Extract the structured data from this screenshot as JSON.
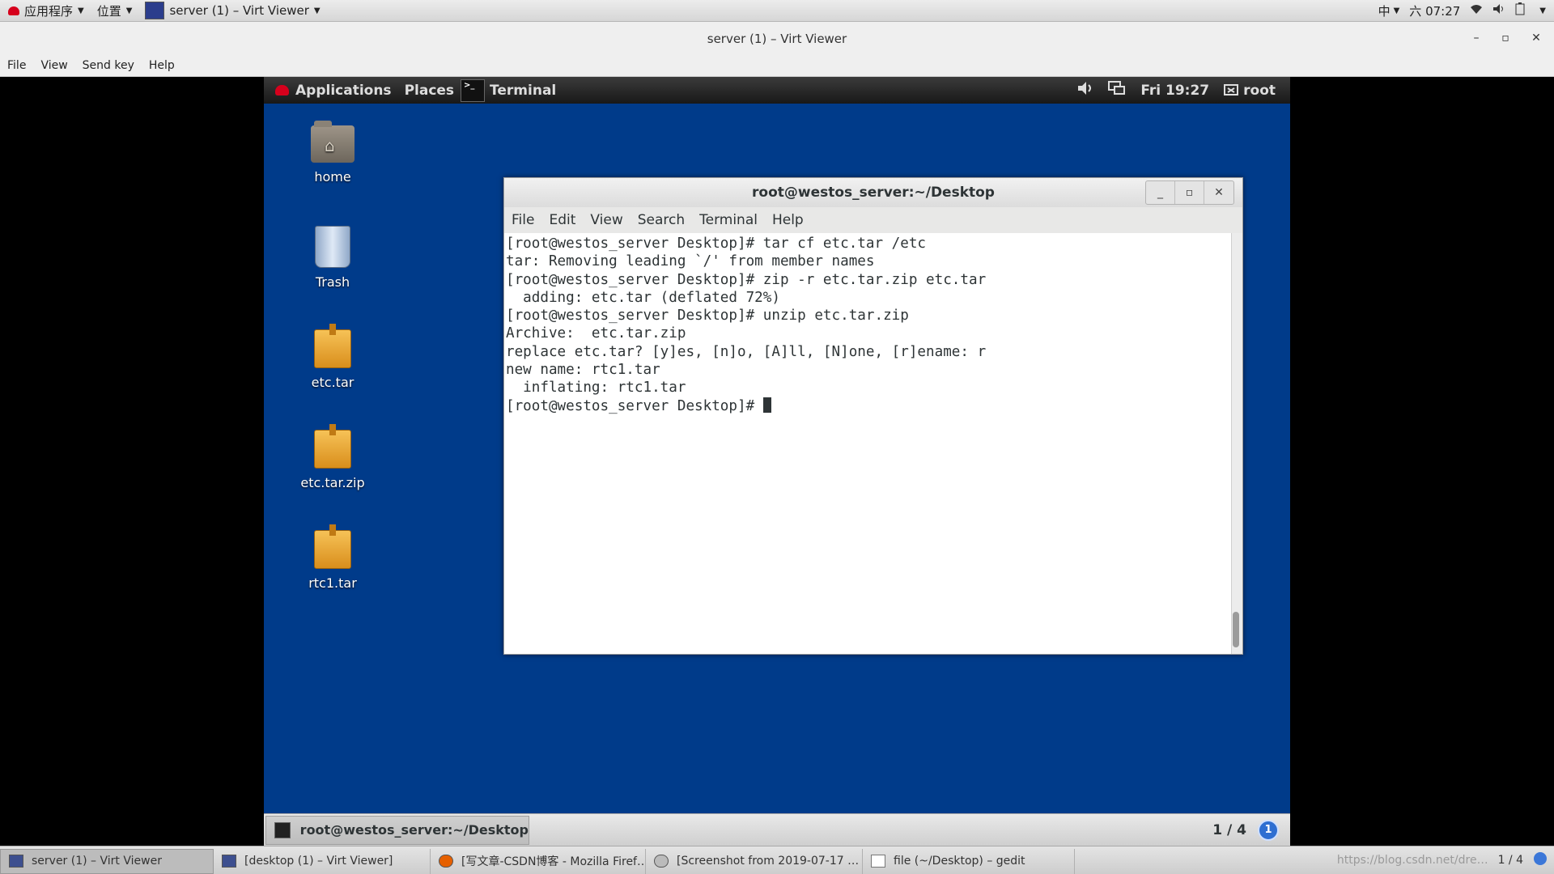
{
  "host_top": {
    "apps_label": "应用程序",
    "places_label": "位置",
    "window_label": "server (1) – Virt Viewer",
    "input_method": "中",
    "clock": "六 07:27"
  },
  "viewer": {
    "title": "server (1) – Virt Viewer",
    "menu": [
      "File",
      "View",
      "Send key",
      "Help"
    ]
  },
  "guest_panel": {
    "applications": "Applications",
    "places": "Places",
    "terminal": "Terminal",
    "clock": "Fri 19:27",
    "user": "root"
  },
  "desktop_icons": [
    {
      "label": "home"
    },
    {
      "label": "Trash"
    },
    {
      "label": "etc.tar"
    },
    {
      "label": "etc.tar.zip"
    },
    {
      "label": "rtc1.tar"
    }
  ],
  "terminal": {
    "title": "root@westos_server:~/Desktop",
    "menu": [
      "File",
      "Edit",
      "View",
      "Search",
      "Terminal",
      "Help"
    ],
    "lines": [
      "[root@westos_server Desktop]# tar cf etc.tar /etc",
      "tar: Removing leading `/' from member names",
      "[root@westos_server Desktop]# zip -r etc.tar.zip etc.tar",
      "  adding: etc.tar (deflated 72%)",
      "[root@westos_server Desktop]# unzip etc.tar.zip",
      "Archive:  etc.tar.zip",
      "replace etc.tar? [y]es, [n]o, [A]ll, [N]one, [r]ename: r",
      "new name: rtc1.tar",
      "  inflating: rtc1.tar",
      "[root@westos_server Desktop]# "
    ]
  },
  "guest_bottom": {
    "task": "root@westos_server:~/Desktop",
    "workspace": "1 / 4",
    "notif_count": "1"
  },
  "host_bottom": {
    "tasks": [
      {
        "label": "server (1) – Virt Viewer"
      },
      {
        "label": "[desktop (1) – Virt Viewer]"
      },
      {
        "label": "[写文章-CSDN博客 - Mozilla Firef…"
      },
      {
        "label": "[Screenshot from 2019-07-17 …"
      },
      {
        "label": "file (~/Desktop) – gedit"
      }
    ],
    "watermark": "https://blog.csdn.net/dre…",
    "workspace": "1 / 4"
  }
}
